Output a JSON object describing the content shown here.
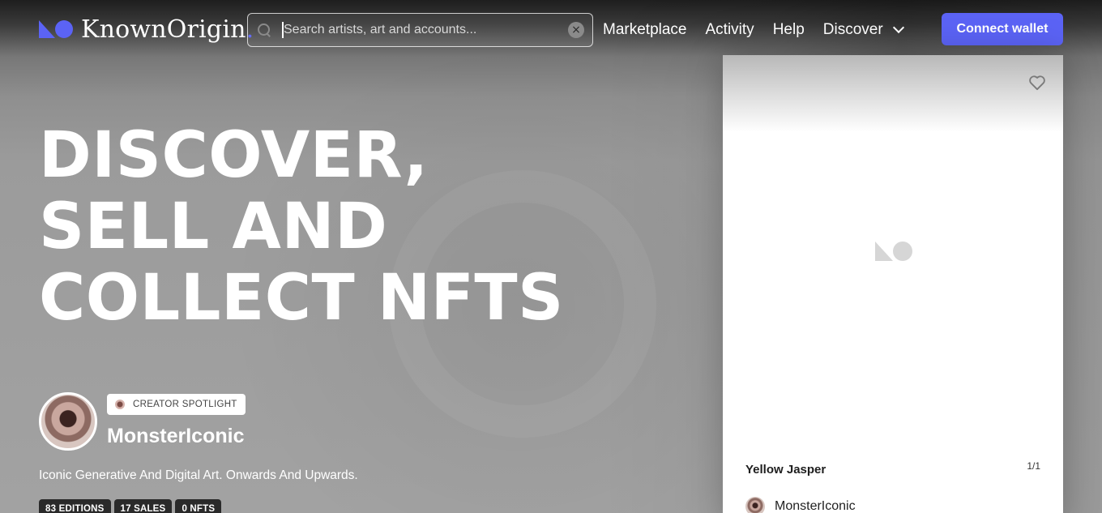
{
  "nav": {
    "logo_text": "KnownOrigin",
    "logo_dot": ".",
    "search_placeholder": "Search artists, art and accounts...",
    "links": [
      "Marketplace",
      "Activity",
      "Help"
    ],
    "discover_label": "Discover",
    "connect_label": "Connect wallet",
    "accent_color": "#5b63f5"
  },
  "hero": {
    "headline": [
      "DISCOVER,",
      "SELL AND",
      "COLLECT NFTS"
    ],
    "spotlight_badge": "CREATOR SPOTLIGHT",
    "creator_name": "MonsterIconic",
    "creator_bio": "Iconic Generative And Digital Art. Onwards And Upwards.",
    "stats": [
      "83 EDITIONS",
      "17 SALES",
      "0 NFTS"
    ]
  },
  "card": {
    "title": "Yellow Jasper",
    "edition": "1/1",
    "artist_name": "MonsterIconic"
  }
}
